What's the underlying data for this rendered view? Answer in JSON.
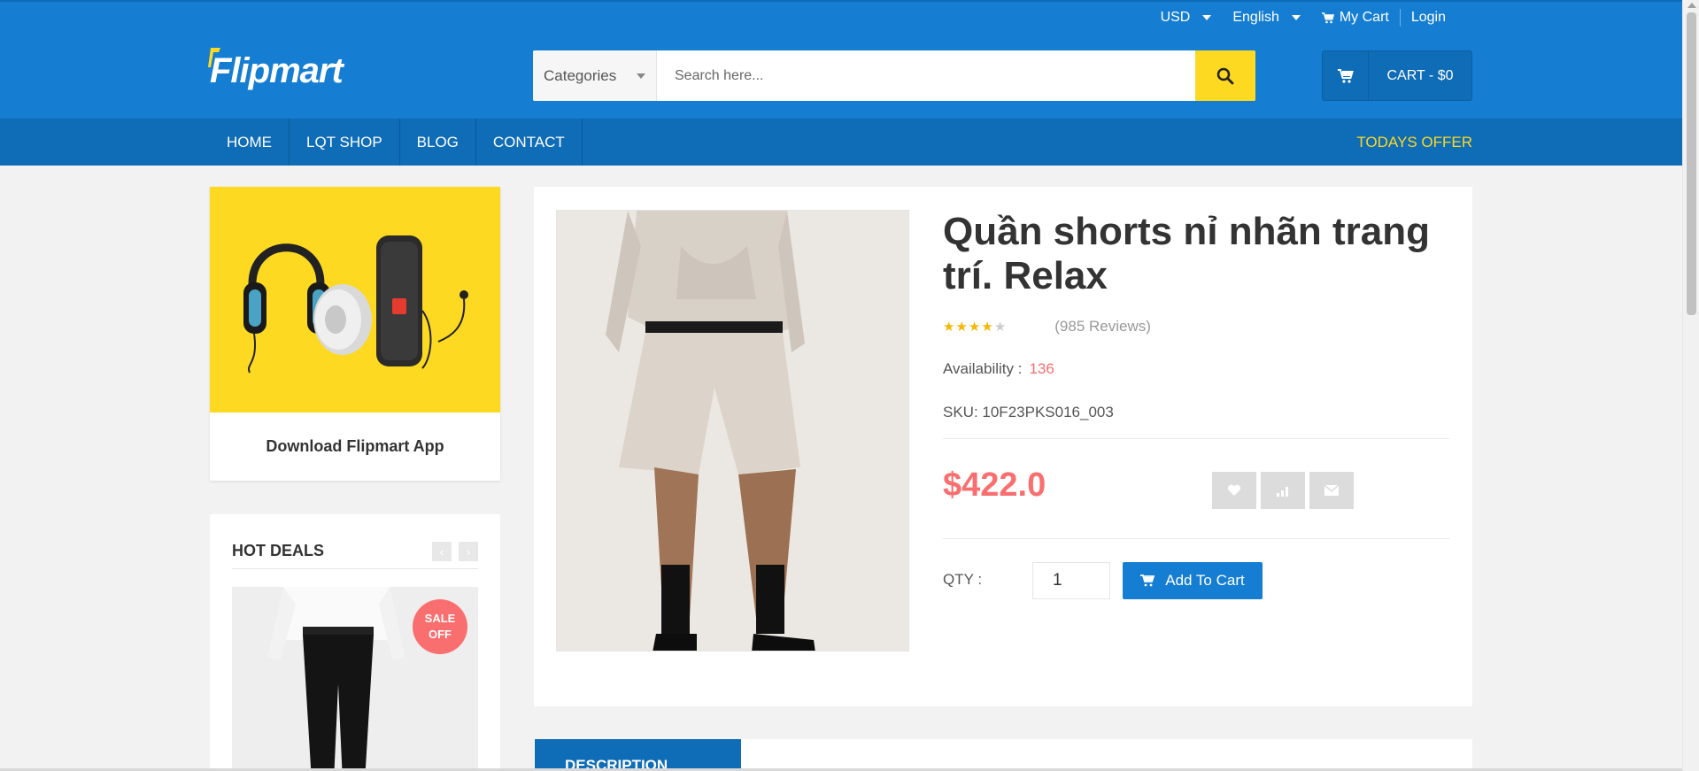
{
  "header": {
    "currency": "USD",
    "language": "English",
    "my_cart": "My Cart",
    "login": "Login",
    "logo": "Flipmart",
    "search": {
      "category": "Categories",
      "placeholder": "Search here..."
    },
    "cart_label": "CART - $0"
  },
  "nav": {
    "items": [
      {
        "label": "HOME"
      },
      {
        "label": "LQT SHOP"
      },
      {
        "label": "BLOG"
      },
      {
        "label": "CONTACT"
      }
    ],
    "offer": "TODAYS OFFER"
  },
  "sidebar": {
    "app_label": "Download Flipmart App",
    "hot_deals": {
      "title": "HOT DEALS",
      "prev": "‹",
      "next": "›",
      "badge_line1": "SALE",
      "badge_line2": "OFF"
    }
  },
  "product": {
    "title": "Quần shorts nỉ nhãn trang trí. Relax",
    "rating": 4,
    "rating_max": 5,
    "reviews": "(985 Reviews)",
    "availability_label": "Availability :",
    "availability_value": "136",
    "sku": "SKU: 10F23PKS016_003",
    "price": "$422.0",
    "qty_label": "QTY :",
    "qty_value": "1",
    "add_to_cart": "Add To Cart"
  },
  "tabs": {
    "description": "DESCRIPTION"
  },
  "colors": {
    "primary": "#157ed2",
    "nav_dark": "#0f6cb6",
    "accent_yellow": "#fdd922",
    "price_red": "#f96f6f"
  }
}
